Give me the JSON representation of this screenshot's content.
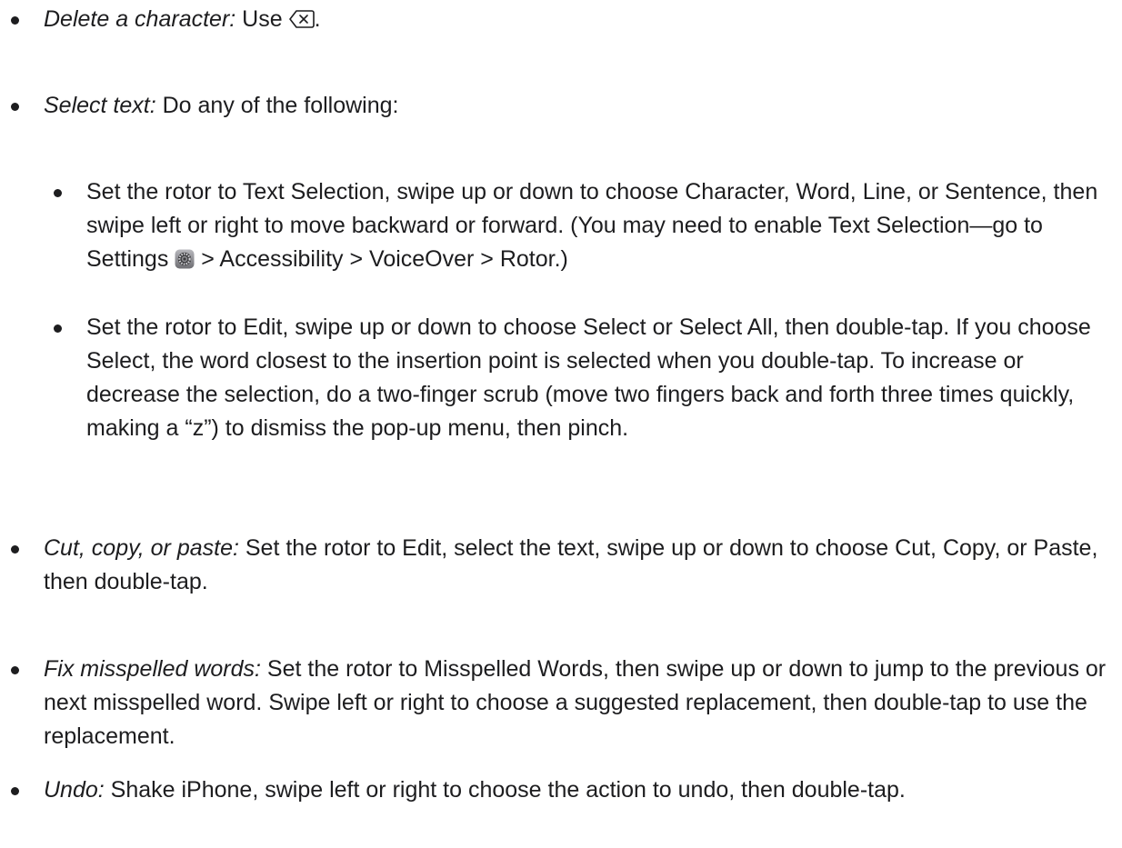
{
  "items": [
    {
      "label": "Delete a character:",
      "text_before_icon": " Use ",
      "icon": "delete-key-icon",
      "text_after_icon": "."
    },
    {
      "label": "Select text:",
      "text": " Do any of the following:",
      "subitems": [
        {
          "text_before_icon": "Set the rotor to Text Selection, swipe up or down to choose Character, Word, Line, or Sentence, then swipe left or right to move backward or forward. (You may need to enable Text Selection—go to Settings ",
          "icon": "settings-gear-icon",
          "text_after_icon": " > Accessibility > VoiceOver > Rotor.)"
        },
        {
          "text": "Set the rotor to Edit, swipe up or down to choose Select or Select All, then double-tap. If you choose Select, the word closest to the insertion point is selected when you double-tap. To increase or decrease the selection, do a two-finger scrub (move two fingers back and forth three times quickly, making a “z”) to dismiss the pop-up menu, then pinch."
        }
      ]
    },
    {
      "label": "Cut, copy, or paste:",
      "text": " Set the rotor to Edit, select the text, swipe up or down to choose Cut, Copy, or Paste, then double-tap."
    },
    {
      "label": "Fix misspelled words:",
      "text": " Set the rotor to Misspelled Words, then swipe up or down to jump to the previous or next misspelled word. Swipe left or right to choose a suggested replacement, then double-tap to use the replacement."
    },
    {
      "label": "Undo:",
      "text": " Shake iPhone, swipe left or right to choose the action to undo, then double-tap."
    }
  ]
}
